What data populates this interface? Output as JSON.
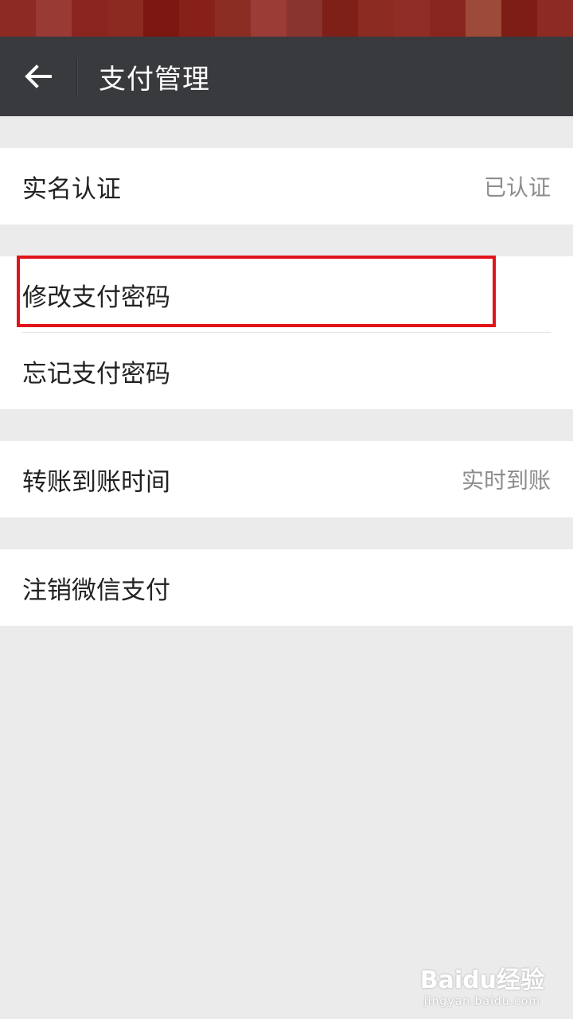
{
  "status_bar": {
    "colors": [
      "#8e2a24",
      "#9a3a34",
      "#8a2520",
      "#8c2a22",
      "#7c1711",
      "#862019",
      "#8c2d24",
      "#9b3c36",
      "#8a3430",
      "#7e1f18",
      "#8c2b22",
      "#902d26",
      "#8a2620",
      "#9e4a38",
      "#7d1d15",
      "#8d2a23"
    ]
  },
  "nav": {
    "back_icon": "arrow-left-icon",
    "title": "支付管理"
  },
  "groups": {
    "g1": {
      "items": [
        {
          "label": "实名认证",
          "value": "已认证"
        }
      ]
    },
    "g2": {
      "items": [
        {
          "label": "修改支付密码"
        },
        {
          "label": "忘记支付密码"
        }
      ]
    },
    "g3": {
      "items": [
        {
          "label": "转账到账时间",
          "value": "实时到账"
        }
      ]
    },
    "g4": {
      "items": [
        {
          "label": "注销微信支付"
        }
      ]
    }
  },
  "watermark": {
    "brand": "Baidu经验",
    "sub": "jingyan.baidu.com"
  },
  "colors": {
    "nav_bg": "#393a3e",
    "page_bg": "#ebebeb",
    "highlight": "#e0141b"
  }
}
